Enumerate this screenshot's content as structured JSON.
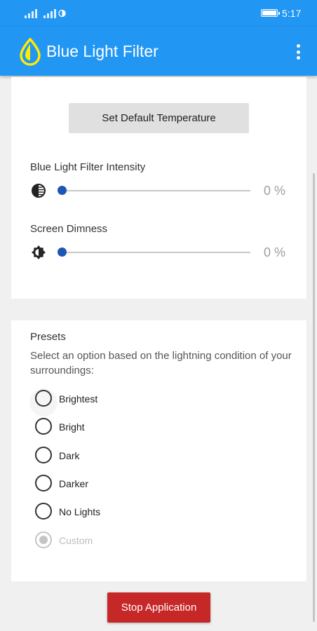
{
  "status_bar": {
    "time": "5:17"
  },
  "app_bar": {
    "title": "Blue Light Filter",
    "menu_icon": "more-vert-icon",
    "logo_icon": "drop-icon"
  },
  "controls": {
    "default_temp_button": "Set Default Temperature",
    "intensity": {
      "label": "Blue Light Filter Intensity",
      "value_text": "0 %",
      "value": 0,
      "icon": "contrast-icon"
    },
    "dimness": {
      "label": "Screen Dimness",
      "value_text": "0 %",
      "value": 0,
      "icon": "brightness-icon"
    }
  },
  "presets": {
    "title": "Presets",
    "description": "Select an option based on the lightning condition of your surroundings:",
    "options": [
      {
        "label": "Brightest",
        "enabled": true,
        "selected": false
      },
      {
        "label": "Bright",
        "enabled": true,
        "selected": false
      },
      {
        "label": "Dark",
        "enabled": true,
        "selected": false
      },
      {
        "label": "Darker",
        "enabled": true,
        "selected": false
      },
      {
        "label": "No Lights",
        "enabled": true,
        "selected": false
      },
      {
        "label": "Custom",
        "enabled": false,
        "selected": true
      }
    ]
  },
  "stop_button": "Stop Application",
  "colors": {
    "primary": "#2196f3",
    "stop": "#c62828",
    "slider_thumb": "#1e56b3",
    "logo": "#ffeb00"
  }
}
